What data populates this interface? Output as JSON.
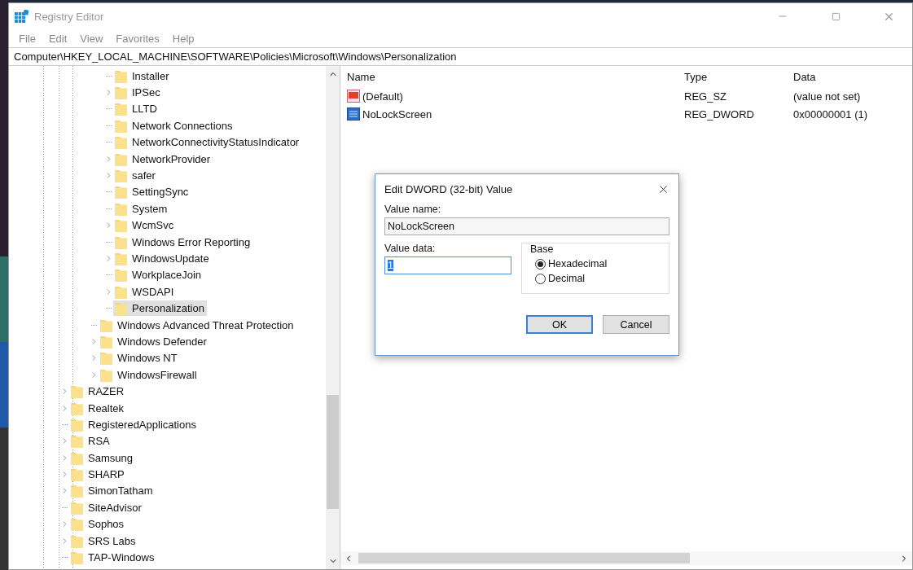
{
  "window": {
    "title": "Registry Editor"
  },
  "menu": [
    "File",
    "Edit",
    "View",
    "Favorites",
    "Help"
  ],
  "address": "Computer\\HKEY_LOCAL_MACHINE\\SOFTWARE\\Policies\\Microsoft\\Windows\\Personalization",
  "tree": {
    "items": [
      {
        "children": [
          {
            "children": [
              {
                "children": [
                  {
                    "label": "Installer",
                    "expandable": false,
                    "selected": false
                  },
                  {
                    "label": "IPSec",
                    "expandable": true,
                    "selected": false
                  },
                  {
                    "label": "LLTD",
                    "expandable": false,
                    "selected": false
                  },
                  {
                    "label": "Network Connections",
                    "expandable": false,
                    "selected": false
                  },
                  {
                    "label": "NetworkConnectivityStatusIndicator",
                    "expandable": false,
                    "selected": false
                  },
                  {
                    "label": "NetworkProvider",
                    "expandable": true,
                    "selected": false
                  },
                  {
                    "label": "safer",
                    "expandable": true,
                    "selected": false
                  },
                  {
                    "label": "SettingSync",
                    "expandable": false,
                    "selected": false
                  },
                  {
                    "label": "System",
                    "expandable": false,
                    "selected": false
                  },
                  {
                    "label": "WcmSvc",
                    "expandable": true,
                    "selected": false
                  },
                  {
                    "label": "Windows Error Reporting",
                    "expandable": false,
                    "selected": false
                  },
                  {
                    "label": "WindowsUpdate",
                    "expandable": true,
                    "selected": false
                  },
                  {
                    "label": "WorkplaceJoin",
                    "expandable": false,
                    "selected": false
                  },
                  {
                    "label": "WSDAPI",
                    "expandable": true,
                    "selected": false
                  },
                  {
                    "label": "Personalization",
                    "expandable": false,
                    "selected": true
                  }
                ]
              },
              {
                "label": "Windows Advanced Threat Protection",
                "expandable": false,
                "selected": false
              },
              {
                "label": "Windows Defender",
                "expandable": true,
                "selected": false
              },
              {
                "label": "Windows NT",
                "expandable": true,
                "selected": false
              },
              {
                "label": "WindowsFirewall",
                "expandable": true,
                "selected": false
              }
            ]
          }
        ]
      },
      {
        "label": "RAZER",
        "expandable": true,
        "selected": false
      },
      {
        "label": "Realtek",
        "expandable": true,
        "selected": false
      },
      {
        "label": "RegisteredApplications",
        "expandable": false,
        "selected": false
      },
      {
        "label": "RSA",
        "expandable": true,
        "selected": false
      },
      {
        "label": "Samsung",
        "expandable": true,
        "selected": false
      },
      {
        "label": "SHARP",
        "expandable": true,
        "selected": false
      },
      {
        "label": "SimonTatham",
        "expandable": true,
        "selected": false
      },
      {
        "label": "SiteAdvisor",
        "expandable": false,
        "selected": false
      },
      {
        "label": "Sophos",
        "expandable": true,
        "selected": false
      },
      {
        "label": "SRS Labs",
        "expandable": true,
        "selected": false
      },
      {
        "label": "TAP-Windows",
        "expandable": false,
        "selected": false
      }
    ]
  },
  "values": {
    "columns": [
      "Name",
      "Type",
      "Data"
    ],
    "rows": [
      {
        "kind": "string",
        "name": "(Default)",
        "type": "REG_SZ",
        "data": "(value not set)"
      },
      {
        "kind": "binary",
        "name": "NoLockScreen",
        "type": "REG_DWORD",
        "data": "0x00000001 (1)"
      }
    ]
  },
  "dialog": {
    "title": "Edit DWORD (32-bit) Value",
    "value_name_label": "Value name:",
    "value_name": "NoLockScreen",
    "value_data_label": "Value data:",
    "value_data": "1",
    "base_label": "Base",
    "base_options": [
      {
        "label": "Hexadecimal",
        "selected": true
      },
      {
        "label": "Decimal",
        "selected": false
      }
    ],
    "buttons": [
      {
        "label": "OK",
        "default": true
      },
      {
        "label": "Cancel",
        "default": false
      }
    ]
  }
}
